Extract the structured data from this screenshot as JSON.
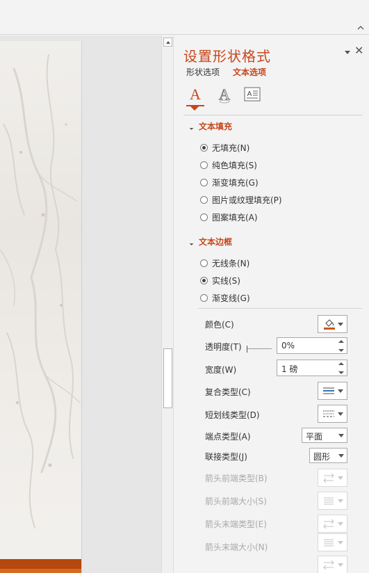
{
  "pane": {
    "title": "设置形状格式",
    "tabs": {
      "shape": "形状选项",
      "text": "文本选项"
    },
    "icons": [
      "text-fill-outline-icon",
      "text-effects-icon",
      "textbox-icon"
    ]
  },
  "text_fill": {
    "heading": "文本填充",
    "options": [
      {
        "label": "无填充(N)",
        "selected": true
      },
      {
        "label": "纯色填充(S)",
        "selected": false
      },
      {
        "label": "渐变填充(G)",
        "selected": false
      },
      {
        "label": "图片或纹理填充(P)",
        "selected": false
      },
      {
        "label": "图案填充(A)",
        "selected": false
      }
    ]
  },
  "text_border": {
    "heading": "文本边框",
    "options": [
      {
        "label": "无线条(N)",
        "selected": false
      },
      {
        "label": "实线(S)",
        "selected": true
      },
      {
        "label": "渐变线(G)",
        "selected": false
      }
    ]
  },
  "properties": {
    "color_label": "颜色(C)",
    "transparency_label": "透明度(T)",
    "transparency_value": "0%",
    "width_label": "宽度(W)",
    "width_value": "1 磅",
    "compound_label": "复合类型(C)",
    "dash_label": "短划线类型(D)",
    "cap_label": "端点类型(A)",
    "cap_value": "平面",
    "join_label": "联接类型(J)",
    "join_value": "圆形",
    "begin_arrow_type_label": "箭头前端类型(B)",
    "begin_arrow_size_label": "箭头前端大小(S)",
    "end_arrow_type_label": "箭头末端类型(E)",
    "end_arrow_size_label": "箭头末端大小(N)"
  },
  "colors": {
    "accent": "#c8461b",
    "pen_swatch": "#c55a11",
    "compound_lines": "#2e75b6"
  }
}
